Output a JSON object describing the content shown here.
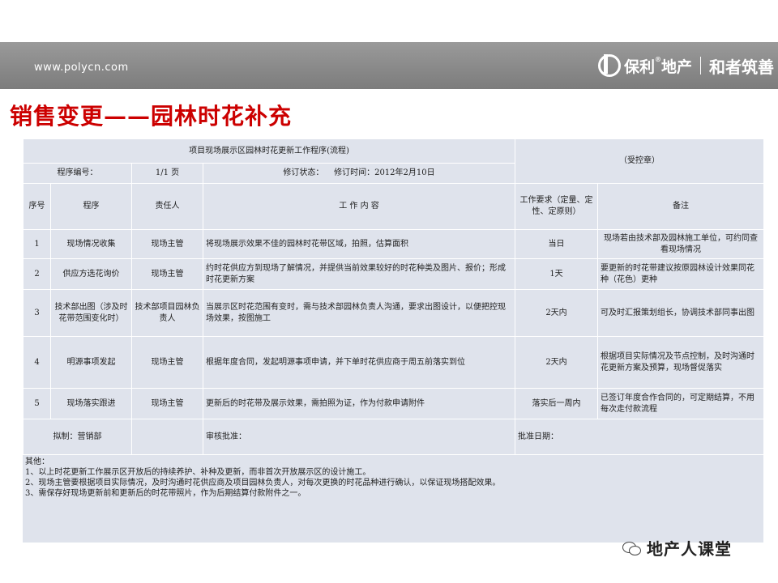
{
  "header": {
    "url": "www.polycn.com",
    "brand": "保利",
    "brand_sup": "®",
    "brand_suffix": "地产",
    "slogan": "和者筑善"
  },
  "title": "销售变更——园林时花补充",
  "table": {
    "doc_title": "项目现场展示区园林时花更新工作程序(流程)",
    "controlled": "（受控章）",
    "prog_no_label": "程序编号：",
    "page": "1/1 页",
    "revision_state": "修订状态：",
    "revision_time": "修订时间：2012年2月10日",
    "headers": {
      "no": "序号",
      "program": "程序",
      "owner": "责任人",
      "content": "工 作 内 容",
      "requirement": "工作要求（定量、定性、定原则）",
      "remark": "备注"
    },
    "rows": [
      {
        "no": "1",
        "program": "现场情况收集",
        "owner": "现场主管",
        "content": "将现场展示效果不佳的园林时花带区域，拍照，估算面积",
        "requirement": "当日",
        "remark": "现场若由技术部及园林施工单位，可约同查看现场情况"
      },
      {
        "no": "2",
        "program": "供应方选花询价",
        "owner": "现场主管",
        "content": "约时花供应方到现场了解情况，并提供当前效果较好的时花种类及图片、报价；形成时花更新方案",
        "requirement": "1天",
        "remark": "要更新的时花带建议按原园林设计效果同花种（花色）更种"
      },
      {
        "no": "3",
        "program": "技术部出图（涉及时花带范围变化时）",
        "owner": "技术部项目园林负责人",
        "content": "当展示区时花范围有变时，需与技术部园林负责人沟通，要求出图设计，以便把控现场效果，按图施工",
        "requirement": "2天内",
        "remark": "可及时汇报策划组长，协调技术部同事出图"
      },
      {
        "no": "4",
        "program": "明源事项发起",
        "owner": "现场主管",
        "content": "根据年度合同，发起明源事项申请，并下单时花供应商于周五前落实到位",
        "requirement": "2天内",
        "remark": "根据项目实际情况及节点控制，及时沟通时花更新方案及预算，现场督促落实"
      },
      {
        "no": "5",
        "program": "现场落实跟进",
        "owner": "现场主管",
        "content": "更新后的时花带及展示效果，需拍照为证，作为付款申请附件",
        "requirement": "落实后一周内",
        "remark": "已签订年度合作合同的，可定期结算，不用每次走付款流程"
      }
    ],
    "footer": {
      "drafter": "拟制：营销部",
      "review": "审核批准：",
      "approve_date": "批准日期："
    }
  },
  "notes": {
    "heading": "其他：",
    "items": [
      "1、以上时花更新工作展示区开放后的持续养护、补种及更新，而非首次开放展示区的设计施工。",
      "2、现场主管要根据项目实际情况，及时沟通时花供应商及项目园林负责人，对每次更换的时花品种进行确认，以保证现场搭配效果。",
      "3、需保存好现场更新前和更新后的时花带照片，作为后期结算付款附件之一。"
    ]
  },
  "watermark": "地产人课堂",
  "colors": {
    "title_red": "#cc0000",
    "table_bg": "#dfe3ec",
    "bar_gray": "#8a8a8a"
  }
}
